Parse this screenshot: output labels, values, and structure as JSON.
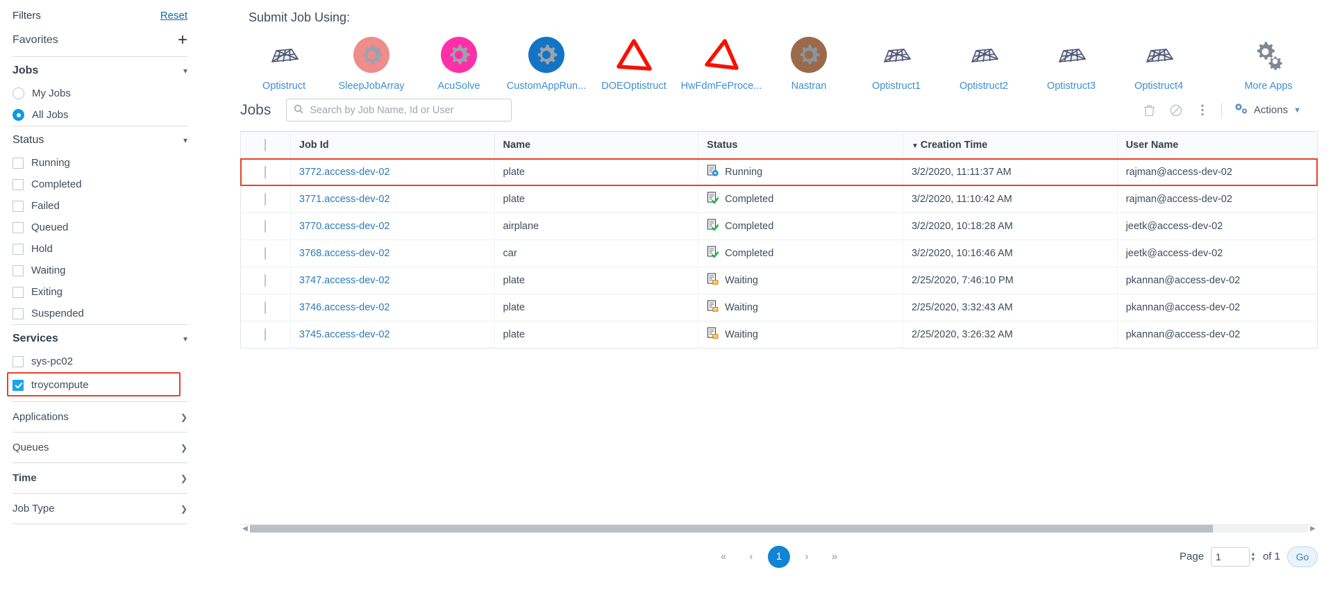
{
  "sidebar": {
    "title": "Filters",
    "reset_label": "Reset",
    "favorites_label": "Favorites",
    "add_favorite_icon": "plus-icon",
    "jobs_group": {
      "title": "Jobs",
      "options": [
        {
          "label": "My Jobs",
          "selected": false
        },
        {
          "label": "All Jobs",
          "selected": true
        }
      ]
    },
    "status_group": {
      "title": "Status",
      "options": [
        {
          "label": "Running",
          "checked": false
        },
        {
          "label": "Completed",
          "checked": false
        },
        {
          "label": "Failed",
          "checked": false
        },
        {
          "label": "Queued",
          "checked": false
        },
        {
          "label": "Hold",
          "checked": false
        },
        {
          "label": "Waiting",
          "checked": false
        },
        {
          "label": "Exiting",
          "checked": false
        },
        {
          "label": "Suspended",
          "checked": false
        }
      ]
    },
    "services_group": {
      "title": "Services",
      "options": [
        {
          "label": "sys-pc02",
          "checked": false
        },
        {
          "label": "troycompute",
          "checked": true
        }
      ]
    },
    "collapsed_groups": [
      {
        "label": "Applications",
        "bold": false
      },
      {
        "label": "Queues",
        "bold": false
      },
      {
        "label": "Time",
        "bold": true
      },
      {
        "label": "Job Type",
        "bold": false
      }
    ]
  },
  "main": {
    "submit_title": "Submit Job Using:",
    "apps": [
      {
        "label": "Optistruct",
        "icon": "mesh-icon",
        "color": "#5b6384"
      },
      {
        "label": "SleepJobArray",
        "icon": "gear-icon",
        "color": "#ef8c8c"
      },
      {
        "label": "AcuSolve",
        "icon": "gear-icon",
        "color": "#ff2fa8"
      },
      {
        "label": "CustomAppRun...",
        "icon": "gear-icon",
        "color": "#1474c4"
      },
      {
        "label": "DOEOptistruct",
        "icon": "triangle-icon",
        "color": "#fa0f00"
      },
      {
        "label": "HwFdmFeProce...",
        "icon": "triangle-icon",
        "color": "#fa0f00"
      },
      {
        "label": "Nastran",
        "icon": "gear-icon",
        "color": "#9a6a4a"
      },
      {
        "label": "Optistruct1",
        "icon": "mesh-icon",
        "color": "#5b6384"
      },
      {
        "label": "Optistruct2",
        "icon": "mesh-icon",
        "color": "#5b6384"
      },
      {
        "label": "Optistruct3",
        "icon": "mesh-icon",
        "color": "#5b6384"
      },
      {
        "label": "Optistruct4",
        "icon": "mesh-icon",
        "color": "#5b6384"
      }
    ],
    "more_apps": {
      "label": "More Apps",
      "icon": "gears-icon"
    }
  },
  "jobs": {
    "heading": "Jobs",
    "search": {
      "value": "",
      "placeholder": "Search by Job Name, Id or User",
      "icon": "search-icon"
    },
    "toolbar": {
      "delete_icon": "trash-icon",
      "cancel_icon": "no-entry-icon",
      "more_icon": "kebab-menu-icon",
      "actions_label": "Actions",
      "actions_icon": "settings-gears-icon",
      "actions_caret": "caret-down-icon"
    },
    "columns": [
      "Job Id",
      "Name",
      "Status",
      "Creation Time",
      "User Name"
    ],
    "sorted_column": "Creation Time",
    "sort_caret": "▼",
    "rows": [
      {
        "job_id": "3772.access-dev-02",
        "name": "plate",
        "status": "Running",
        "status_icon": "doc-gear-icon",
        "creation_time": "3/2/2020, 11:11:37 AM",
        "user": "rajman@access-dev-02",
        "highlighted": true
      },
      {
        "job_id": "3771.access-dev-02",
        "name": "plate",
        "status": "Completed",
        "status_icon": "doc-check-icon",
        "creation_time": "3/2/2020, 11:10:42 AM",
        "user": "rajman@access-dev-02",
        "highlighted": false
      },
      {
        "job_id": "3770.access-dev-02",
        "name": "airplane",
        "status": "Completed",
        "status_icon": "doc-check-icon",
        "creation_time": "3/2/2020, 10:18:28 AM",
        "user": "jeetk@access-dev-02",
        "highlighted": false
      },
      {
        "job_id": "3768.access-dev-02",
        "name": "car",
        "status": "Completed",
        "status_icon": "doc-check-icon",
        "creation_time": "3/2/2020, 10:16:46 AM",
        "user": "jeetk@access-dev-02",
        "highlighted": false
      },
      {
        "job_id": "3747.access-dev-02",
        "name": "plate",
        "status": "Waiting",
        "status_icon": "doc-clock-icon",
        "creation_time": "2/25/2020, 7:46:10 PM",
        "user": "pkannan@access-dev-02",
        "highlighted": false
      },
      {
        "job_id": "3746.access-dev-02",
        "name": "plate",
        "status": "Waiting",
        "status_icon": "doc-clock-icon",
        "creation_time": "2/25/2020, 3:32:43 AM",
        "user": "pkannan@access-dev-02",
        "highlighted": false
      },
      {
        "job_id": "3745.access-dev-02",
        "name": "plate",
        "status": "Waiting",
        "status_icon": "doc-clock-icon",
        "creation_time": "2/25/2020, 3:26:32 AM",
        "user": "pkannan@access-dev-02",
        "highlighted": false
      }
    ]
  },
  "pagination": {
    "first": "«",
    "prev": "‹",
    "current_page": "1",
    "next": "›",
    "last": "»",
    "page_label": "Page",
    "page_value": "1",
    "of_label": "of 1",
    "go_label": "Go"
  },
  "colors": {
    "accent": "#1184d6",
    "link": "#2a7ab9",
    "highlight": "#e8402a",
    "checkbox_on": "#1aa5e8"
  }
}
